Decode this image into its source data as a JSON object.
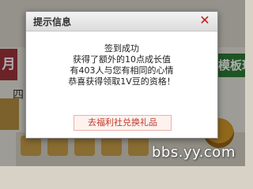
{
  "background": {
    "left_tab": "月",
    "right_tab": "模板玩",
    "left_char": "四"
  },
  "dialog": {
    "title": "提示信息",
    "close_symbol": "✕",
    "message_lines": [
      "签到成功",
      "获得了额外的10点成长值",
      "有403人与您有相同的心情",
      "恭喜获得领取1V豆的资格！"
    ],
    "action_label": "去福利社兑换礼品"
  },
  "watermark": "bbs.yy.com",
  "colors": {
    "close": "#c8161d",
    "action_text": "#c0392b",
    "left_tab_bg": "#a0343b",
    "right_tab_bg": "#2f7d36"
  }
}
